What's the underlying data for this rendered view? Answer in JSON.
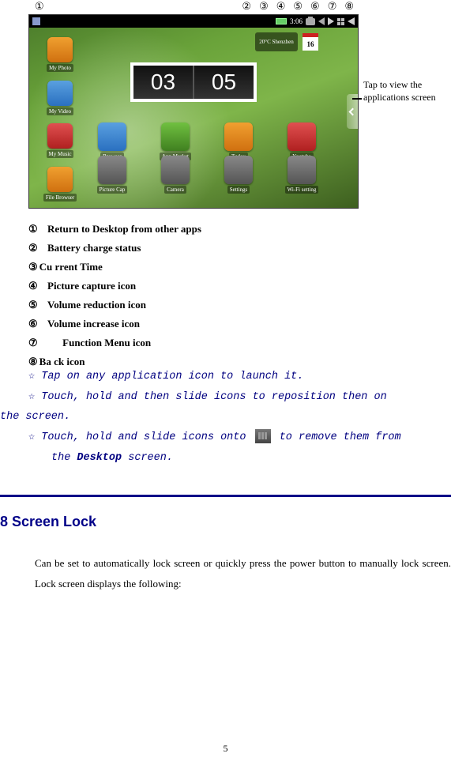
{
  "markers": {
    "m1": "①",
    "m2": "②",
    "m3": "③",
    "m4": "④",
    "m5": "⑤",
    "m6": "⑥",
    "m7": "⑦",
    "m8": "⑧"
  },
  "status_bar": {
    "time": "3:06",
    "time_suffix": ""
  },
  "weather": {
    "text": "20°C Shenzhen"
  },
  "calendar": {
    "day": "16"
  },
  "clock": {
    "hh": "03",
    "mm": "05"
  },
  "dock_left_labels": [
    "My Photo",
    "My Video",
    "My Music",
    "File Browser"
  ],
  "mid_row_labels": [
    "Browser",
    "App Market",
    "Tudou",
    "Youtube"
  ],
  "bottom_row_labels": [
    "Picture Cap",
    "Camera",
    "Settings",
    "Wi-Fi setting"
  ],
  "callout": "Tap to view the applications screen",
  "legend": [
    "Return to Desktop from other apps",
    "Battery charge status",
    "Cu rrent Time",
    "Picture capture icon",
    "Volume reduction icon",
    "Volume increase icon",
    "Function Menu icon",
    "Ba ck icon"
  ],
  "legend_num7_spacer": "      ",
  "tips": {
    "t1": "Tap on any application icon to launch it.",
    "t2a": "Touch, hold and then slide icons to reposition then on",
    "t2b": "the screen.",
    "t3a": "Touch, hold and slide icons onto",
    "t3b": "to remove them from",
    "t3c": "the ",
    "t3d": "Desktop",
    "t3e": " screen."
  },
  "section": {
    "heading": "8 Screen Lock",
    "body": "Can be set to automatically lock screen or quickly press the power button to manually lock screen. Lock screen displays the following:"
  },
  "page_number": "5"
}
